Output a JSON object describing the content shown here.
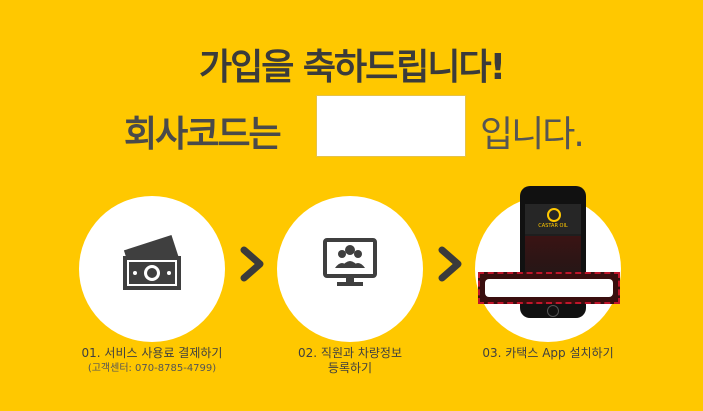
{
  "title": "가입을 축하드립니다!",
  "company_code": {
    "label": "회사코드는",
    "value": "",
    "suffix": "입니다."
  },
  "app_screen": {
    "name": "CASTAR OIL"
  },
  "steps": [
    {
      "label": "01. 서비스 사용료 결제하기",
      "sub": "(고객센터: 070-8785-4799)",
      "icon": "money-icon"
    },
    {
      "label_line1": "02. 직원과 차량정보",
      "label_line2": "등록하기",
      "icon": "meeting-monitor-icon"
    },
    {
      "label": "03. 카택스 App 설치하기",
      "icon": "smartphone-icon"
    }
  ],
  "colors": {
    "background": "#FFC800",
    "text": "#3b3b3b",
    "accent": "#c0152b"
  }
}
